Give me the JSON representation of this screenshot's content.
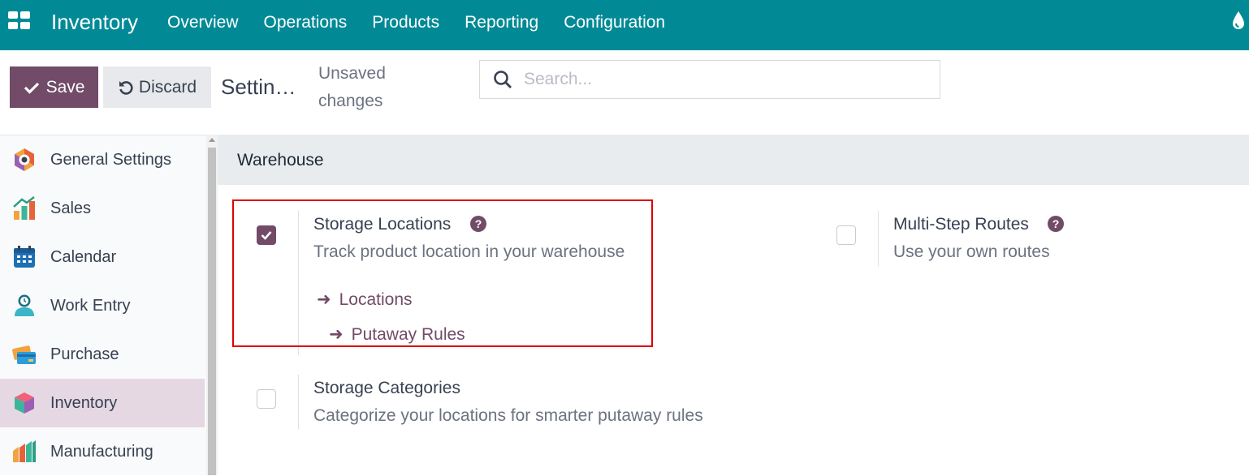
{
  "navbar": {
    "brand": "Inventory",
    "menu": [
      "Overview",
      "Operations",
      "Products",
      "Reporting",
      "Configuration"
    ]
  },
  "control_panel": {
    "save_label": "Save",
    "discard_label": "Discard",
    "breadcrumb": "Settings",
    "unsaved": "Unsaved changes",
    "search_placeholder": "Search..."
  },
  "sidebar": {
    "items": [
      {
        "label": "General Settings",
        "icon": "general-settings-icon"
      },
      {
        "label": "Sales",
        "icon": "sales-icon"
      },
      {
        "label": "Calendar",
        "icon": "calendar-icon"
      },
      {
        "label": "Work Entry",
        "icon": "work-entry-icon"
      },
      {
        "label": "Purchase",
        "icon": "purchase-icon"
      },
      {
        "label": "Inventory",
        "icon": "inventory-icon",
        "active": true
      },
      {
        "label": "Manufacturing",
        "icon": "manufacturing-icon"
      }
    ]
  },
  "main": {
    "section_title": "Warehouse",
    "settings": [
      {
        "title": "Storage Locations",
        "description": "Track product location in your warehouse",
        "checked": true,
        "links": [
          "Locations",
          "Putaway Rules"
        ]
      },
      {
        "title": "Multi-Step Routes",
        "description": "Use your own routes",
        "checked": false
      },
      {
        "title": "Storage Categories",
        "description": "Categorize your locations for smarter putaway rules",
        "checked": false
      }
    ]
  },
  "colors": {
    "navbar": "#018a96",
    "primary": "#714b67",
    "highlight": "#e00000"
  }
}
